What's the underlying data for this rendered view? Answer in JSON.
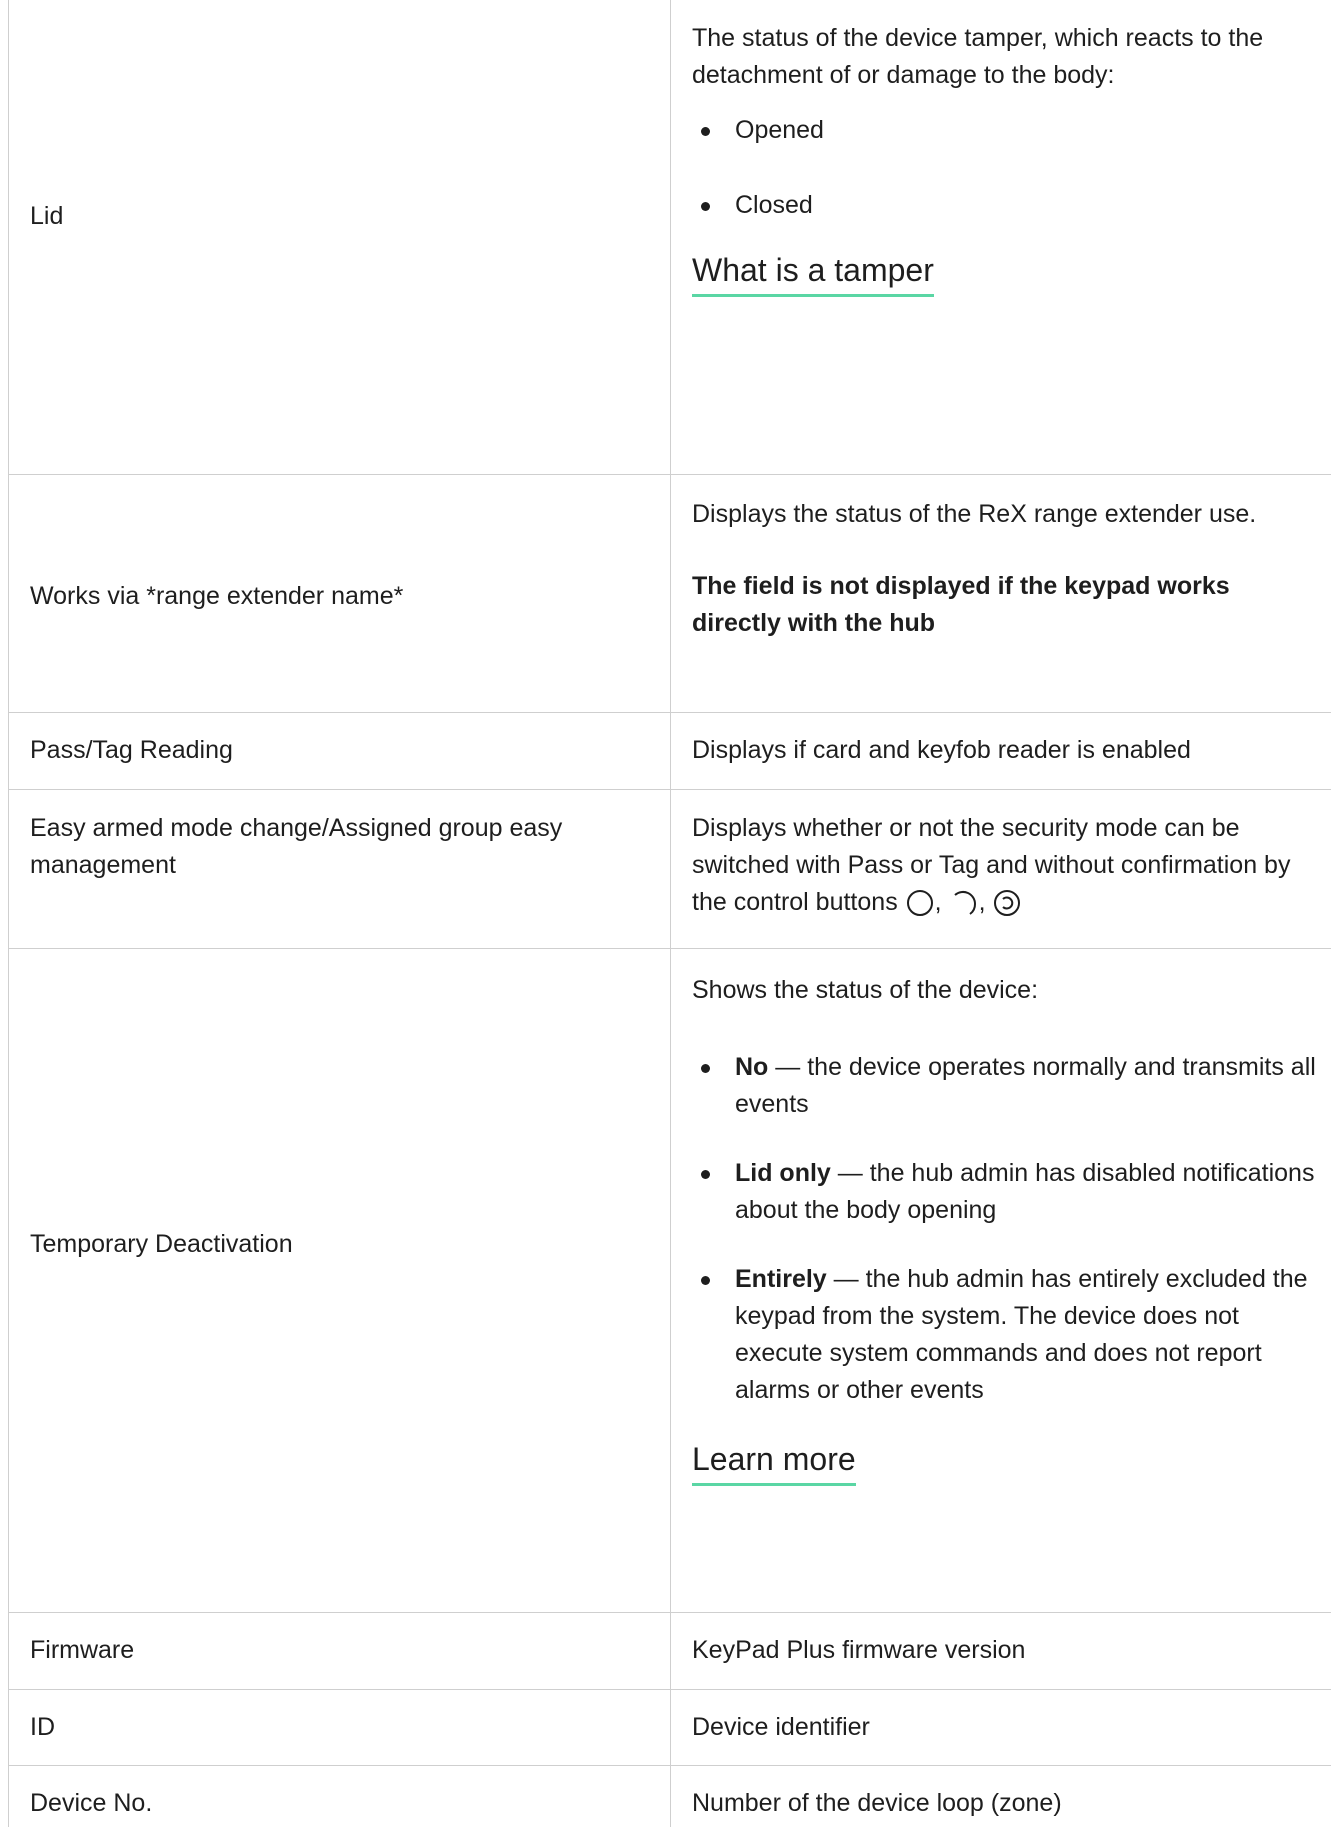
{
  "rows": [
    {
      "name": "Lid",
      "description": "The status of the device tamper, which reacts to the detachment of or damage to the body:",
      "bullets": [
        "Opened",
        "Closed"
      ],
      "link": "What is a tamper"
    },
    {
      "name": "Works via *range extender name*",
      "description": "Displays the status of the ReX range extender use.",
      "note": "The field is not displayed if the keypad works directly with the hub"
    },
    {
      "name": "Pass/Tag Reading",
      "description": "Displays if card and keyfob reader is enabled"
    },
    {
      "name": "Easy armed mode change/Assigned group easy management",
      "description": "Displays whether or not the security mode can be switched with Pass or Tag and without confirmation by the control buttons",
      "icons": [
        "arm-circle-icon",
        "disarm-crescent-icon",
        "night-mode-icon"
      ]
    },
    {
      "name": "Temporary Deactivation",
      "description": "Shows the status of the device:",
      "options": [
        {
          "term": "No",
          "text": "— the device operates normally and transmits all events"
        },
        {
          "term": "Lid only",
          "text": "— the hub admin has disabled notifications about the body opening"
        },
        {
          "term": "Entirely",
          "text": "— the hub admin has entirely excluded the keypad from the system. The device does not execute system commands and does not report alarms or other events"
        }
      ],
      "link": "Learn more"
    },
    {
      "name": "Firmware",
      "description": "KeyPad Plus firmware version"
    },
    {
      "name": "ID",
      "description": "Device identifier"
    },
    {
      "name": "Device No.",
      "description": "Number of the device loop (zone)"
    }
  ],
  "colors": {
    "border": "#cfcfcf",
    "link_underline": "#5ad6a4",
    "text": "#1e1e1e"
  }
}
